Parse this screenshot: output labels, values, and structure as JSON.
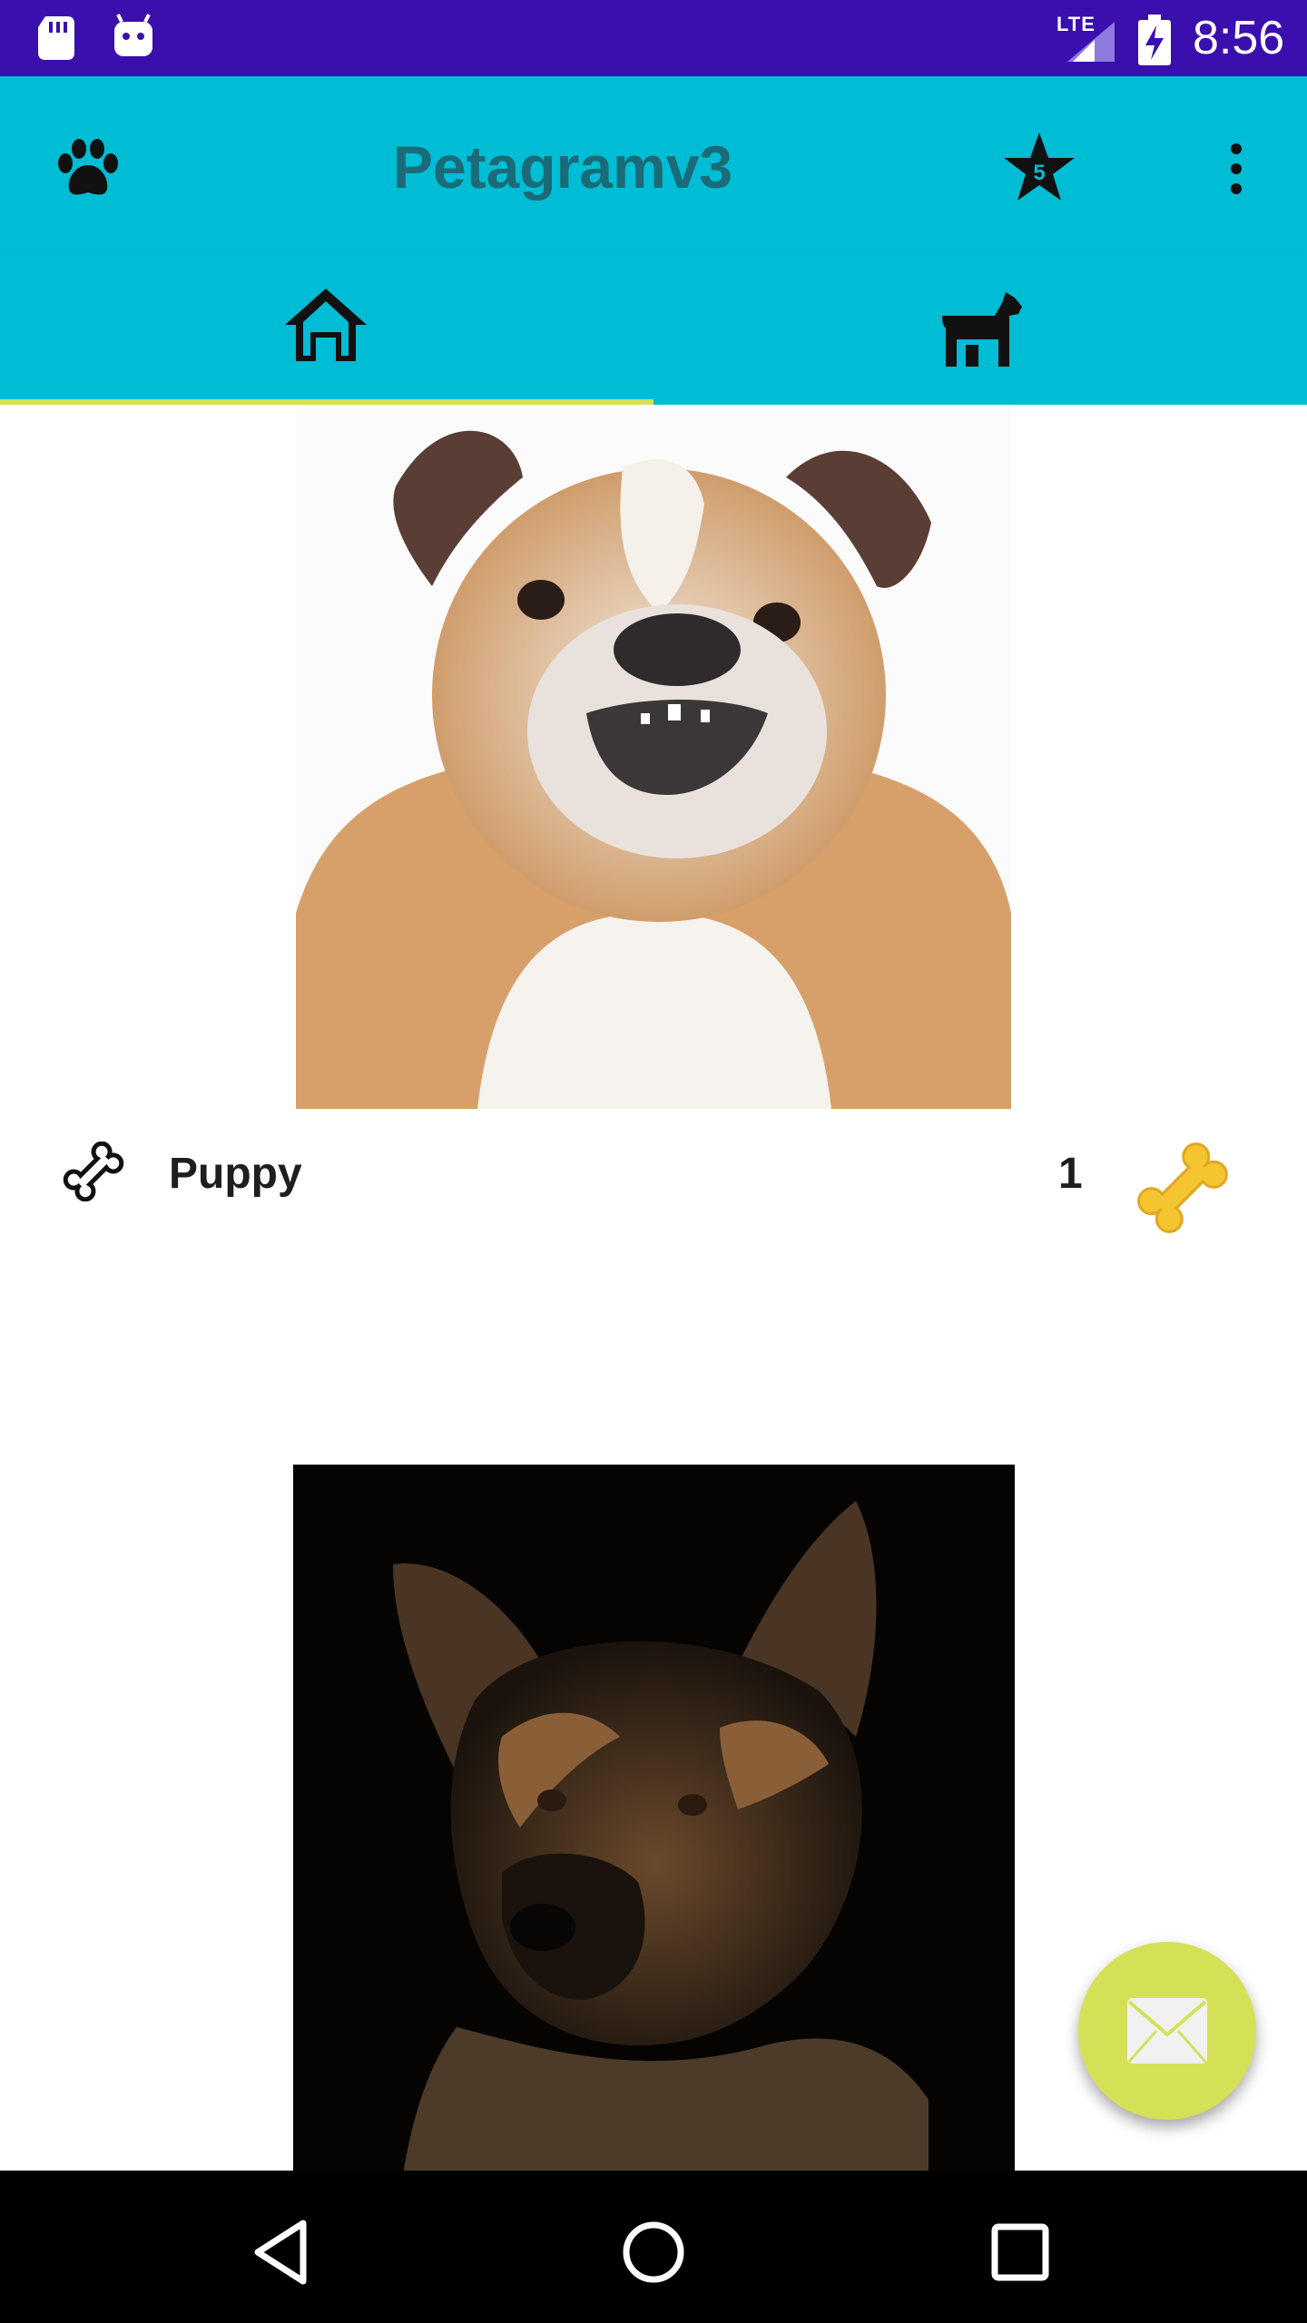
{
  "status_bar": {
    "network_type": "LTE",
    "time": "8:56",
    "icons": [
      "sd-card-icon",
      "android-icon",
      "signal-icon",
      "battery-charging-icon"
    ]
  },
  "toolbar": {
    "title": "Petagramv3",
    "star_badge": "5",
    "icons": [
      "paw-icon",
      "star-icon",
      "overflow-menu-icon"
    ]
  },
  "tabs": [
    {
      "icon": "home-icon",
      "selected": true
    },
    {
      "icon": "dog-icon",
      "selected": false
    }
  ],
  "pets": [
    {
      "name": "Puppy",
      "likes": "1",
      "photo": "bulldog"
    },
    {
      "photo": "german-shepherd"
    }
  ],
  "fab": {
    "icon": "mail-icon"
  },
  "nav_bar": {
    "icons": [
      "back-icon",
      "home-circle-icon",
      "recents-icon"
    ]
  },
  "colors": {
    "status_bar": "#3a0fae",
    "primary": "#00bcd4",
    "title": "#1b6a77",
    "accent": "#d4e157",
    "bone_gold": "#f5c431"
  }
}
